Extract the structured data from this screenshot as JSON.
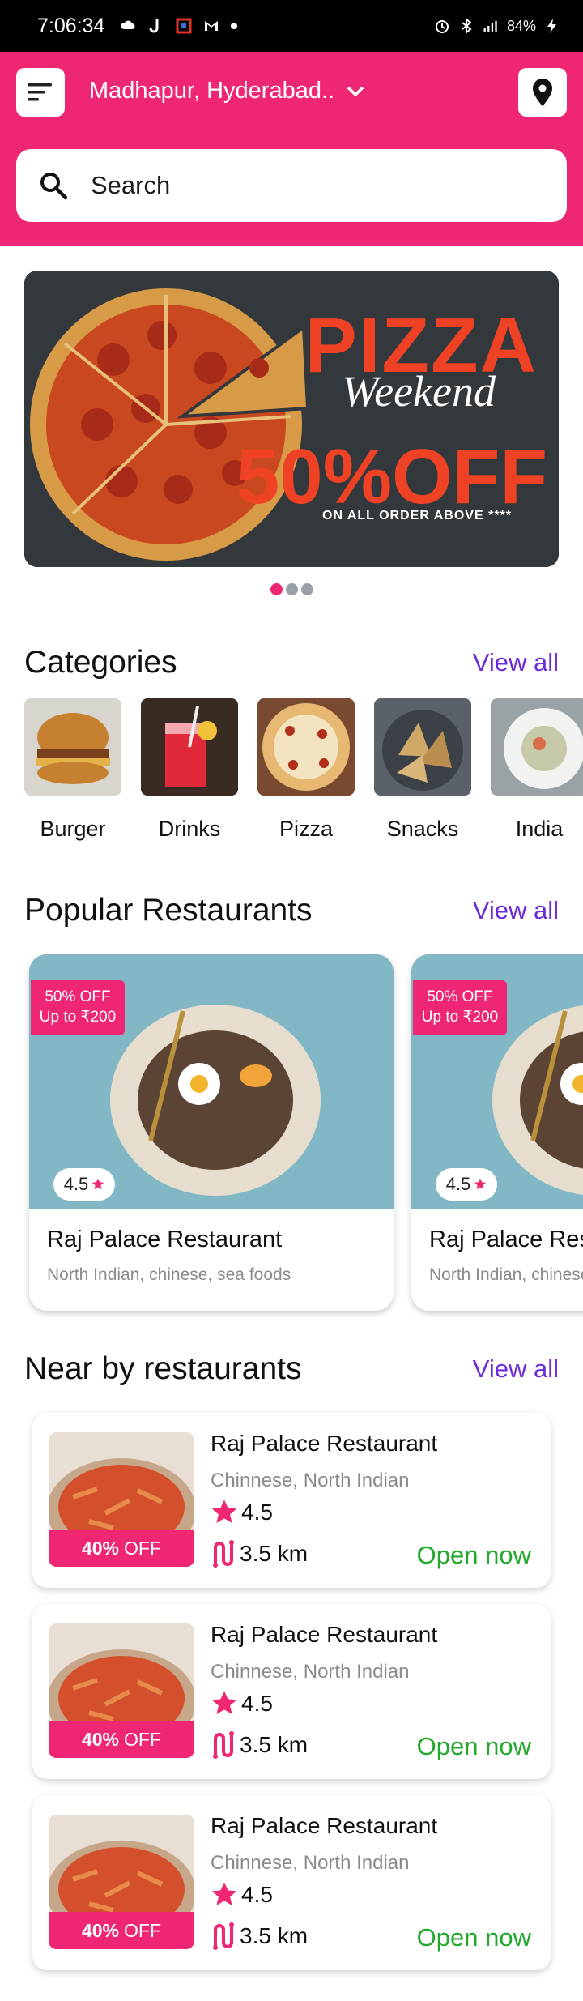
{
  "status_bar": {
    "time": "7:06:34",
    "battery": "84%"
  },
  "header": {
    "location": "Madhapur, Hyderabad..",
    "search_placeholder": "Search"
  },
  "banner": {
    "title": "PIZZA",
    "subtitle": "Weekend",
    "offer": "50%OFF",
    "note": "ON ALL ORDER ABOVE ****",
    "slides": 3,
    "active_slide": 1
  },
  "categories": {
    "title": "Categories",
    "view_all": "View all",
    "items": [
      {
        "label": "Burger"
      },
      {
        "label": "Drinks"
      },
      {
        "label": "Pizza"
      },
      {
        "label": "Snacks"
      },
      {
        "label": "India"
      }
    ]
  },
  "popular": {
    "title": "Popular Restaurants",
    "view_all": "View all",
    "cards": [
      {
        "offer_line1": "50% OFF",
        "offer_line2": "Up to ₹200",
        "rating": "4.5",
        "name": "Raj Palace Restaurant",
        "cuisine": "North Indian, chinese, sea foods"
      },
      {
        "offer_line1": "50% OFF",
        "offer_line2": "Up to ₹200",
        "rating": "4.5",
        "name": "Raj Palace Restaurant",
        "cuisine": "North Indian, chinese, sea foods"
      }
    ]
  },
  "nearby": {
    "title": "Near by restaurants",
    "view_all": "View all",
    "cards": [
      {
        "offer_pct": "40%",
        "offer_label": "OFF",
        "name": "Raj Palace Restaurant",
        "cuisine": "Chinnese, North Indian",
        "rating": "4.5",
        "distance": "3.5 km",
        "status": "Open now"
      },
      {
        "offer_pct": "40%",
        "offer_label": "OFF",
        "name": "Raj Palace Restaurant",
        "cuisine": "Chinnese, North Indian",
        "rating": "4.5",
        "distance": "3.5 km",
        "status": "Open now"
      },
      {
        "offer_pct": "40%",
        "offer_label": "OFF",
        "name": "Raj Palace Restaurant",
        "cuisine": "Chinnese, North Indian",
        "rating": "4.5",
        "distance": "3.5 km",
        "status": "Open now"
      }
    ]
  },
  "colors": {
    "brand": "#ef2673",
    "link": "#6b2bd9",
    "open": "#22a82b"
  },
  "icons": [
    "menu-icon",
    "chevron-down-icon",
    "location-pin-icon",
    "search-icon",
    "star-icon",
    "route-icon"
  ]
}
